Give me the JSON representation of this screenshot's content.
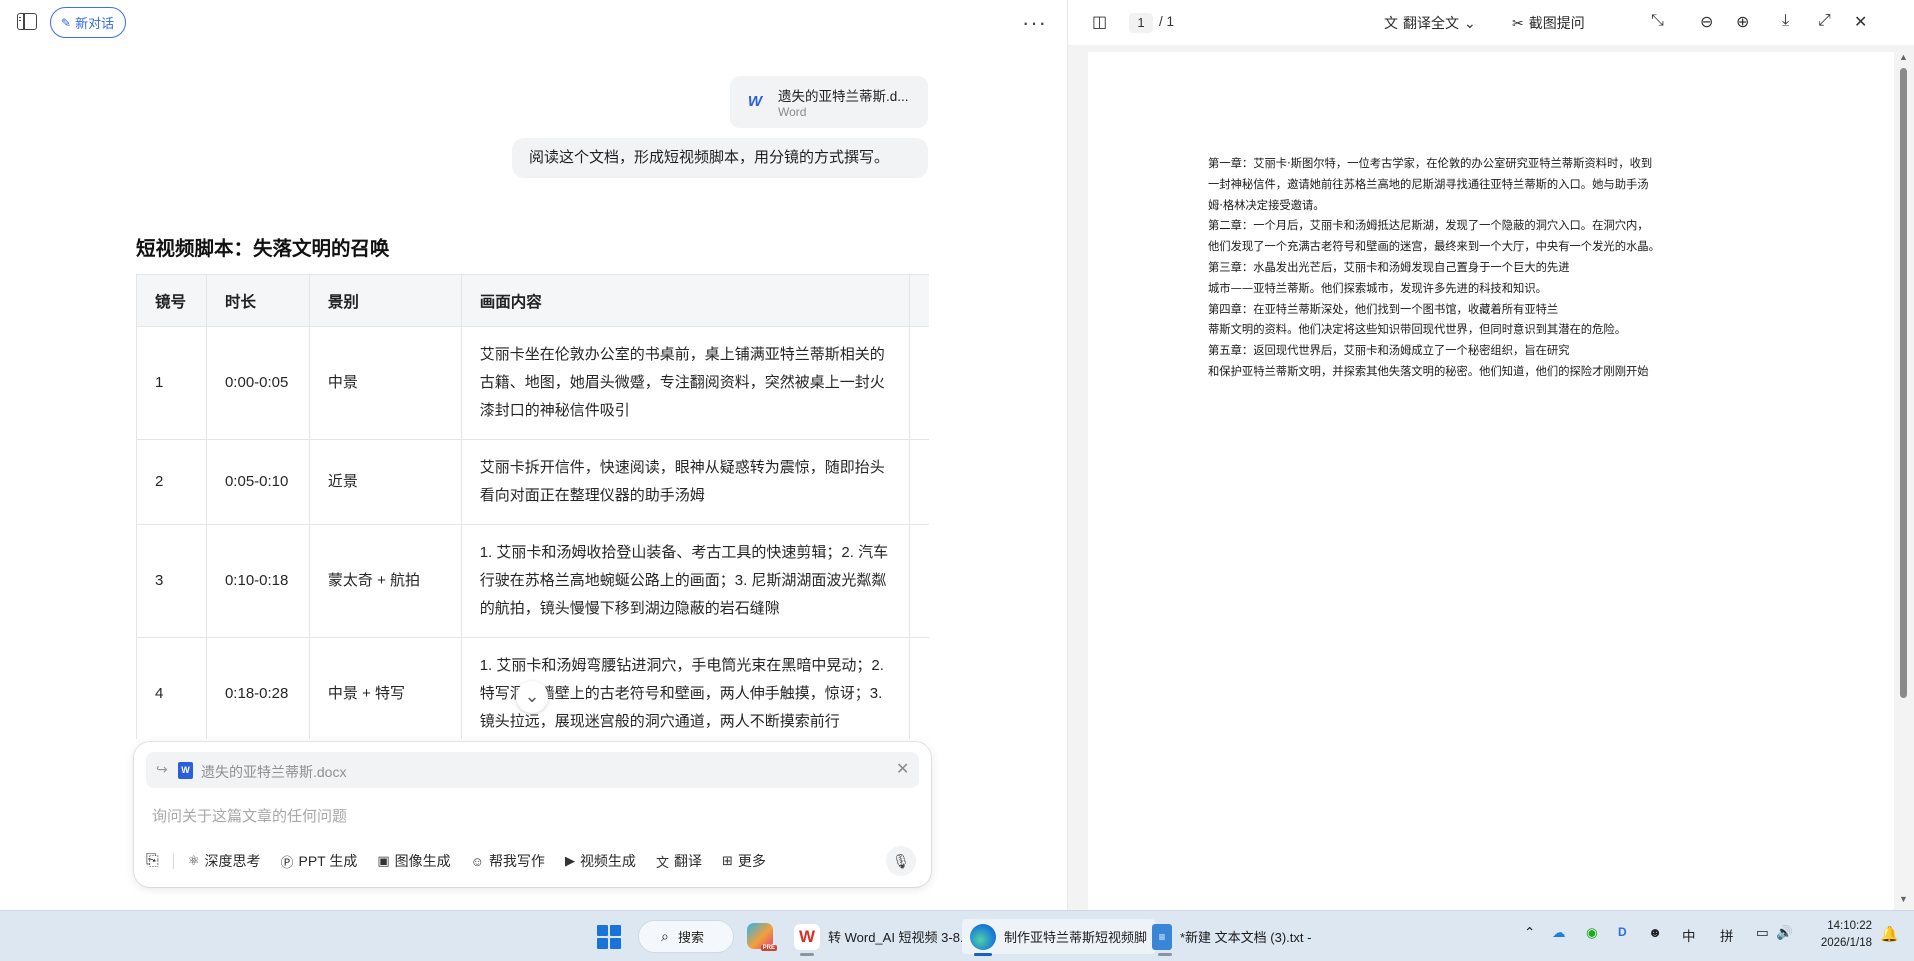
{
  "chat": {
    "new_chat_label": "新对话",
    "more_label": "···",
    "attachment": {
      "name": "遗失的亚特兰蒂斯.d...",
      "type": "Word"
    },
    "user_message": "阅读这个文档，形成短视频脚本，用分镜的方式撰写。",
    "script_title": "短视频脚本：失落文明的召唤",
    "table": {
      "headers": [
        "镜号",
        "时长",
        "景别",
        "画面内容",
        ""
      ],
      "rows": [
        {
          "no": "1",
          "duration": "0:00-0:05",
          "shot": "中景",
          "content": "艾丽卡坐在伦敦办公室的书桌前，桌上铺满亚特兰蒂斯相关的古籍、地图，她眉头微蹙，专注翻阅资料，突然被桌上一封火漆封口的神秘信件吸引"
        },
        {
          "no": "2",
          "duration": "0:05-0:10",
          "shot": "近景",
          "content": "艾丽卡拆开信件，快速阅读，眼神从疑惑转为震惊，随即抬头看向对面正在整理仪器的助手汤姆"
        },
        {
          "no": "3",
          "duration": "0:10-0:18",
          "shot": "蒙太奇 + 航拍",
          "content": "1. 艾丽卡和汤姆收拾登山装备、考古工具的快速剪辑；2. 汽车行驶在苏格兰高地蜿蜒公路上的画面；3. 尼斯湖湖面波光粼粼的航拍，镜头慢慢下移到湖边隐蔽的岩石缝隙"
        },
        {
          "no": "4",
          "duration": "0:18-0:28",
          "shot": "中景 + 特写",
          "content": "1. 艾丽卡和汤姆弯腰钻进洞穴，手电筒光束在黑暗中晃动；2. 特写洞穴墙壁上的古老符号和壁画，两人伸手触摸，惊讶；3. 镜头拉远，展现迷宫般的洞穴通道，两人不断摸索前行"
        }
      ]
    },
    "input": {
      "attached_file": "遗失的亚特兰蒂斯.docx",
      "placeholder": "询问关于这篇文章的任何问题",
      "tools": [
        "深度思考",
        "PPT 生成",
        "图像生成",
        "帮我写作",
        "视频生成",
        "翻译",
        "更多"
      ]
    }
  },
  "viewer": {
    "page_current": "1",
    "page_total": "/ 1",
    "translate_label": "翻译全文",
    "screenshot_label": "截图提问",
    "doc_lines": [
      "第一章：艾丽卡·斯图尔特，一位考古学家，在伦敦的办公室研究亚特兰蒂斯资料时，收到",
      "一封神秘信件，邀请她前往苏格兰高地的尼斯湖寻找通往亚特兰蒂斯的入口。她与助手汤",
      "姆·格林决定接受邀请。",
      "第二章：一个月后，艾丽卡和汤姆抵达尼斯湖，发现了一个隐蔽的洞穴入口。在洞穴内，",
      "他们发现了一个充满古老符号和壁画的迷宫，最终来到一个大厅，中央有一个发光的水晶。",
      "第三章：水晶发出光芒后，艾丽卡和汤姆发现自己置身于一个巨大的先进",
      "城市——亚特兰蒂斯。他们探索城市，发现许多先进的科技和知识。",
      "第四章：在亚特兰蒂斯深处，他们找到一个图书馆，收藏着所有亚特兰",
      "蒂斯文明的资料。他们决定将这些知识带回现代世界，但同时意识到其潜在的危险。",
      "第五章：返回现代世界后，艾丽卡和汤姆成立了一个秘密组织，旨在研究",
      "和保护亚特兰蒂斯文明，并探索其他失落文明的秘密。他们知道，他们的探险才刚刚开始"
    ]
  },
  "taskbar": {
    "search_label": "搜索",
    "apps": [
      {
        "label": "转 Word_AI 短视频 3-8.c"
      },
      {
        "label": "制作亚特兰蒂斯短视频脚"
      },
      {
        "label": "*新建 文本文档 (3).txt - "
      }
    ],
    "tray": {
      "ime1": "中",
      "ime2": "拼"
    },
    "time": "14:10:22",
    "date": "2026/1/18"
  },
  "colors": {
    "accent": "#2f6bf0",
    "taskbar": "#dde7f1"
  }
}
